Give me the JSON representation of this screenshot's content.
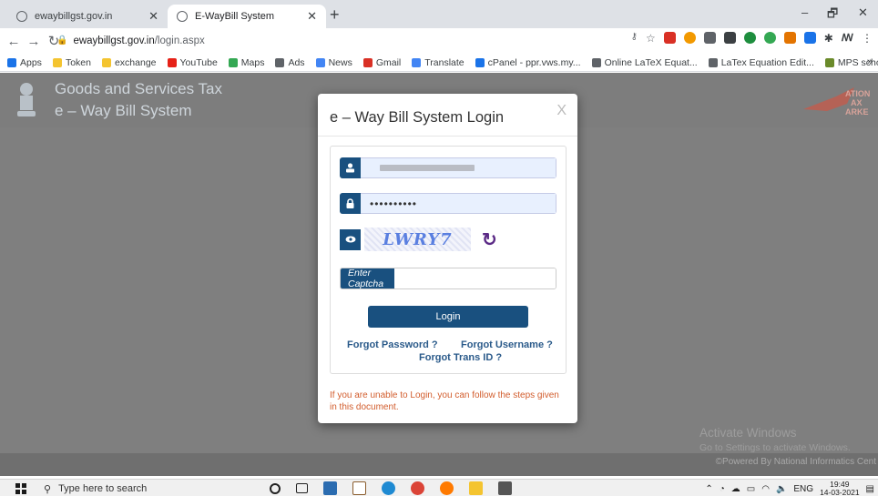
{
  "browser": {
    "tabs": [
      {
        "title": "ewaybillgst.gov.in",
        "active": false
      },
      {
        "title": "E-WayBill System",
        "active": true
      }
    ],
    "new_tab": "+",
    "window_controls": {
      "minimize": "–",
      "maximize": "🗗",
      "close": "✕"
    },
    "url": {
      "host": "ewaybillgst.gov.in",
      "path": "/login.aspx"
    },
    "bookmarks": [
      {
        "label": "Apps",
        "color": "#1a73e8"
      },
      {
        "label": "Token",
        "color": "#f4c430"
      },
      {
        "label": "exchange",
        "color": "#f4c430"
      },
      {
        "label": "YouTube",
        "color": "#e62117"
      },
      {
        "label": "Maps",
        "color": "#34a853"
      },
      {
        "label": "Ads",
        "color": "#5f6368"
      },
      {
        "label": "News",
        "color": "#4285f4"
      },
      {
        "label": "Gmail",
        "color": "#d93025"
      },
      {
        "label": "Translate",
        "color": "#4285f4"
      },
      {
        "label": "cPanel - ppr.vws.my...",
        "color": "#1a73e8"
      },
      {
        "label": "Online LaTeX Equat...",
        "color": "#5f6368"
      },
      {
        "label": "LaTex Equation Edit...",
        "color": "#5f6368"
      },
      {
        "label": "MPS school",
        "color": "#6a8a2a"
      }
    ],
    "bookmarks_more": "»"
  },
  "site": {
    "title_line1": "Goods and Services Tax",
    "title_line2": "e – Way Bill System",
    "footer": "©Powered By National Informatics Cent"
  },
  "login": {
    "title": "e – Way Bill System Login",
    "close": "X",
    "password_value": "••••••••••",
    "captcha_text": "LWRY7",
    "captcha_label": "Enter Captcha",
    "login_button": "Login",
    "forgot_password": "Forgot Password ?",
    "forgot_username": "Forgot Username ?",
    "forgot_trans_id": "Forgot Trans ID ?",
    "help_text": "If you are unable to Login, you can follow the steps given in this document.",
    "accent_color": "#19507f"
  },
  "watermark": {
    "line1": "Activate Windows",
    "line2": "Go to Settings to activate Windows."
  },
  "taskbar": {
    "search_placeholder": "Type here to search",
    "language": "ENG",
    "time": "19:49",
    "date": "14-03-2021"
  }
}
